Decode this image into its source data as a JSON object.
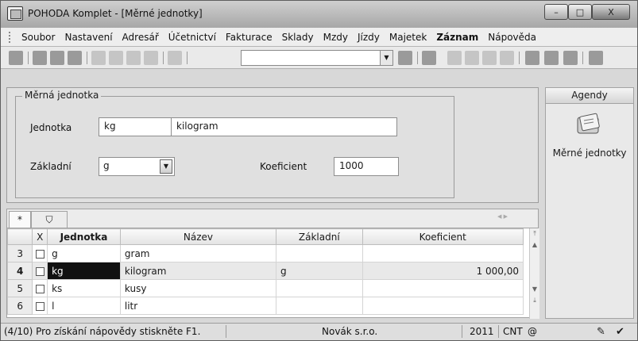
{
  "window": {
    "title": "POHODA Komplet - [Měrné jednotky]",
    "min": "–",
    "max": "□",
    "close": "X"
  },
  "menu": [
    "Soubor",
    "Nastavení",
    "Adresář",
    "Účetnictví",
    "Fakturace",
    "Sklady",
    "Mzdy",
    "Jízdy",
    "Majetek",
    "Záznam",
    "Nápověda"
  ],
  "toolbar": {
    "combo_value": ""
  },
  "form": {
    "group_title": "Měrná jednotka",
    "jednotka_label": "Jednotka",
    "jednotka_code": "kg",
    "jednotka_name": "kilogram",
    "zakladni_label": "Základní",
    "zakladni_value": "g",
    "koeficient_label": "Koeficient",
    "koeficient_value": "1000"
  },
  "agendy": {
    "title": "Agendy",
    "item_label": "Měrné jednotky"
  },
  "grid": {
    "tab_new": "*",
    "columns": {
      "x": "X",
      "jednotka": "Jednotka",
      "nazev": "Název",
      "zakladni": "Základní",
      "koeficient": "Koeficient"
    },
    "rows": [
      {
        "num": "3",
        "jednotka": "g",
        "nazev": "gram",
        "zakladni": "",
        "koeficient": ""
      },
      {
        "num": "4",
        "jednotka": "kg",
        "nazev": "kilogram",
        "zakladni": "g",
        "koeficient": "1 000,00"
      },
      {
        "num": "5",
        "jednotka": "ks",
        "nazev": "kusy",
        "zakladni": "",
        "koeficient": ""
      },
      {
        "num": "6",
        "jednotka": "l",
        "nazev": "litr",
        "zakladni": "",
        "koeficient": ""
      }
    ]
  },
  "status": {
    "help": "(4/10) Pro získání nápovědy stiskněte F1.",
    "company": "Novák s.r.o.",
    "year": "2011",
    "cnt": "CNT",
    "at": "@"
  }
}
